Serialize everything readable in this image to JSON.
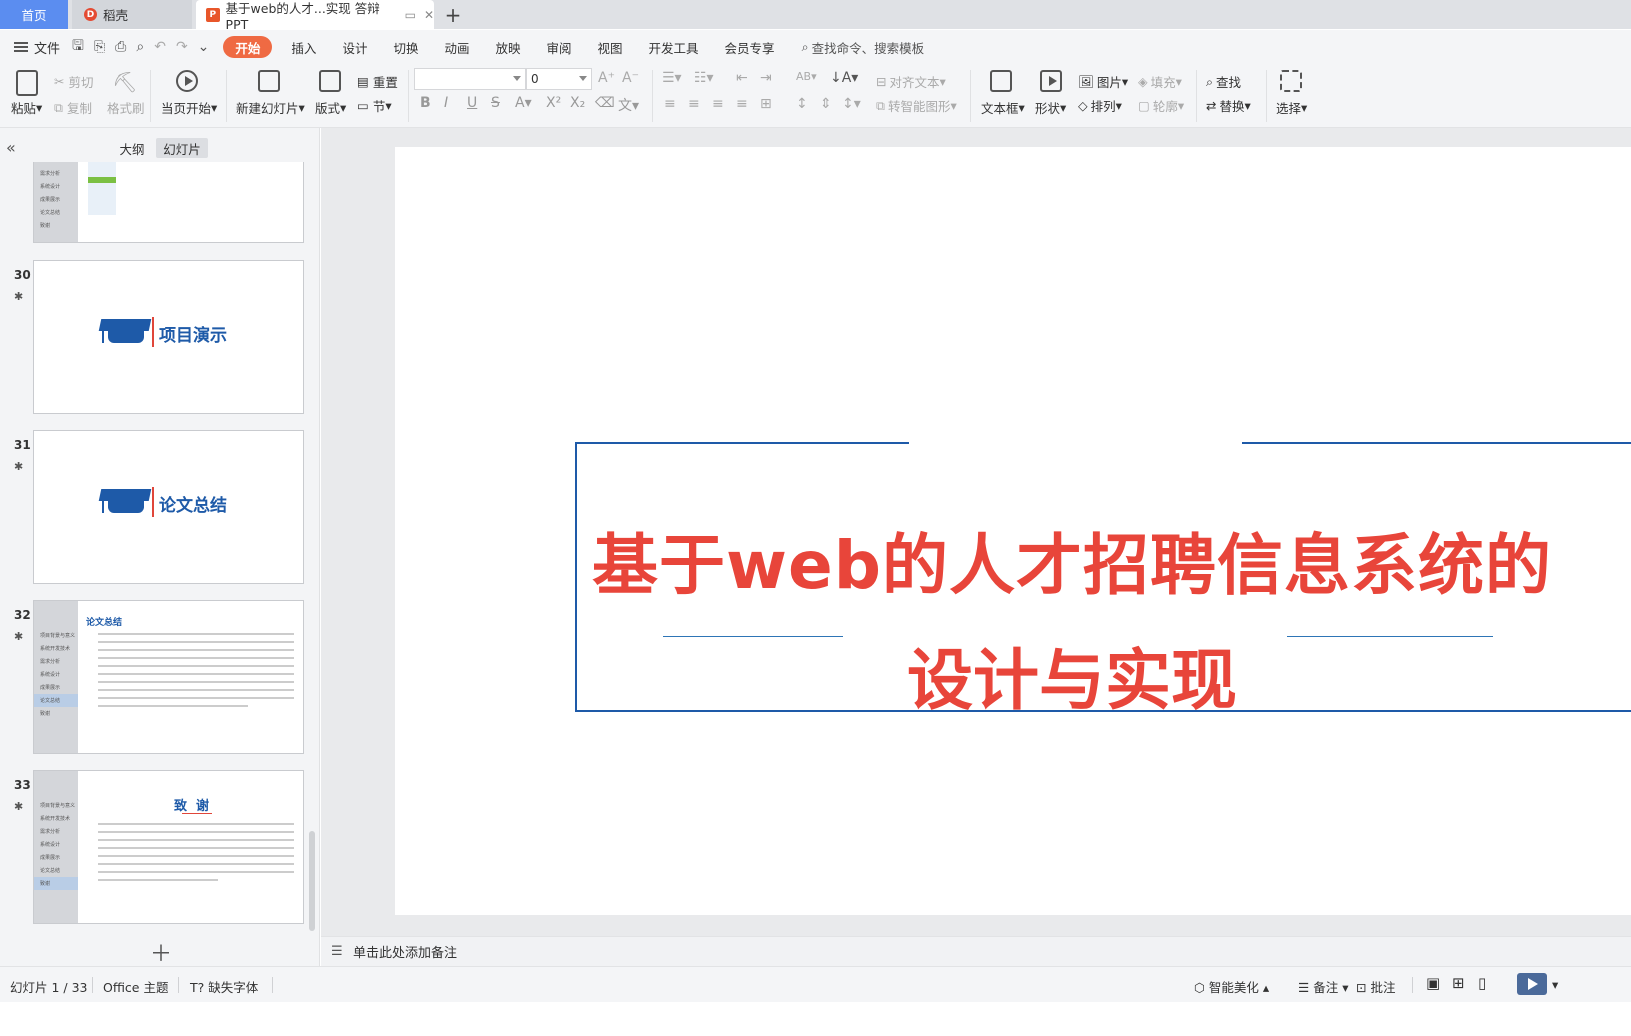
{
  "tabs": {
    "home": "首页",
    "daoke": "稻壳",
    "document": "基于web的人才...实现 答辩PPT",
    "add": "+"
  },
  "menu": {
    "file": "文件",
    "items": [
      "开始",
      "插入",
      "设计",
      "切换",
      "动画",
      "放映",
      "审阅",
      "视图",
      "开发工具",
      "会员专享"
    ],
    "search": "查找命令、搜索模板"
  },
  "ribbon": {
    "paste": "粘贴",
    "cut": "剪切",
    "copy": "复制",
    "format_painter": "格式刷",
    "from_current": "当页开始",
    "new_slide": "新建幻灯片",
    "layout": "版式",
    "reset": "重置",
    "section": "节",
    "font_name": "",
    "font_size": "0",
    "align_text": "对齐文本",
    "smart_art": "转智能图形",
    "textbox": "文本框",
    "shape": "形状",
    "picture": "图片",
    "fill": "填充",
    "arrange": "排列",
    "outline": "轮廓",
    "find": "查找",
    "replace": "替换",
    "select": "选择"
  },
  "panel": {
    "outline_tab": "大纲",
    "slides_tab": "幻灯片",
    "thumbs": [
      {
        "num": "30",
        "title": "项目演示"
      },
      {
        "num": "31",
        "title": "论文总结"
      },
      {
        "num": "32",
        "title": "论文总结"
      },
      {
        "num": "33",
        "title": "致  谢"
      }
    ],
    "top_thumb_side": [
      "需求分析",
      "系统设计",
      "成果展示",
      "论文总结",
      "致谢"
    ],
    "side_items": [
      "项目背景与意义",
      "系统开发技术",
      "需求分析",
      "系统设计",
      "成果展示",
      "论文总结",
      "致谢"
    ]
  },
  "slide": {
    "title_line1": "基于web的人才招聘信息系统的",
    "title_line2": "设计与实现"
  },
  "notes": "单击此处添加备注",
  "status": {
    "slide_info": "幻灯片 1 / 33",
    "theme": "Office 主题",
    "missing_font": "缺失字体",
    "beautify": "智能美化",
    "notes_btn": "备注",
    "comments": "批注"
  }
}
